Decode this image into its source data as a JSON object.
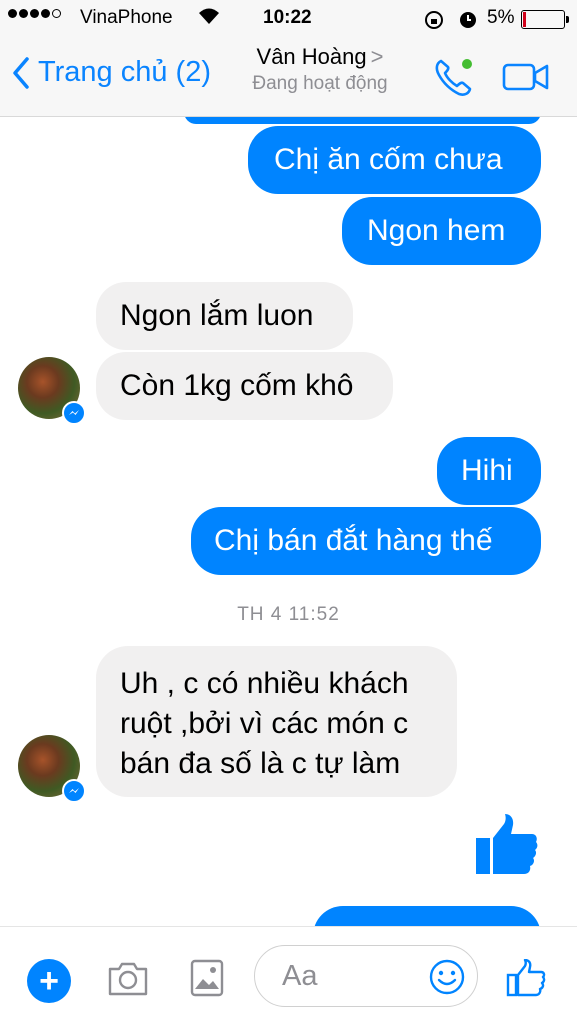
{
  "status_bar": {
    "carrier": "VinaPhone",
    "time": "10:22",
    "battery": "5%",
    "battery_color": "#d0021b"
  },
  "header": {
    "back_label": "Trang chủ (2)",
    "contact_name": "Vân Hoàng",
    "contact_status": "Đang hoạt động",
    "online_dot_color": "#44bd32",
    "accent_color": "#0a84ff"
  },
  "messages": [
    {
      "side": "out",
      "text": "Chị ăn cốm chưa"
    },
    {
      "side": "out",
      "text": "Ngon hem"
    },
    {
      "side": "in",
      "text": "Ngon lắm luon"
    },
    {
      "side": "in",
      "text": "Còn 1kg cốm khô"
    },
    {
      "side": "out",
      "text": "Hihi"
    },
    {
      "side": "out",
      "text": "Chị bán đắt hàng thế"
    },
    {
      "side": "in",
      "lines": [
        "Uh , c có nhiều khách",
        "ruột ,bởi vì các món c",
        "bán đa số là c tự làm"
      ]
    }
  ],
  "timestamp": "TH 4 11:52",
  "bubble_colors": {
    "outgoing": "#0084ff",
    "incoming": "#f1f0f0"
  },
  "composer": {
    "placeholder": "Aa",
    "icons": [
      "plus-icon",
      "camera-icon",
      "image-icon",
      "smiley-icon",
      "like-icon"
    ]
  }
}
